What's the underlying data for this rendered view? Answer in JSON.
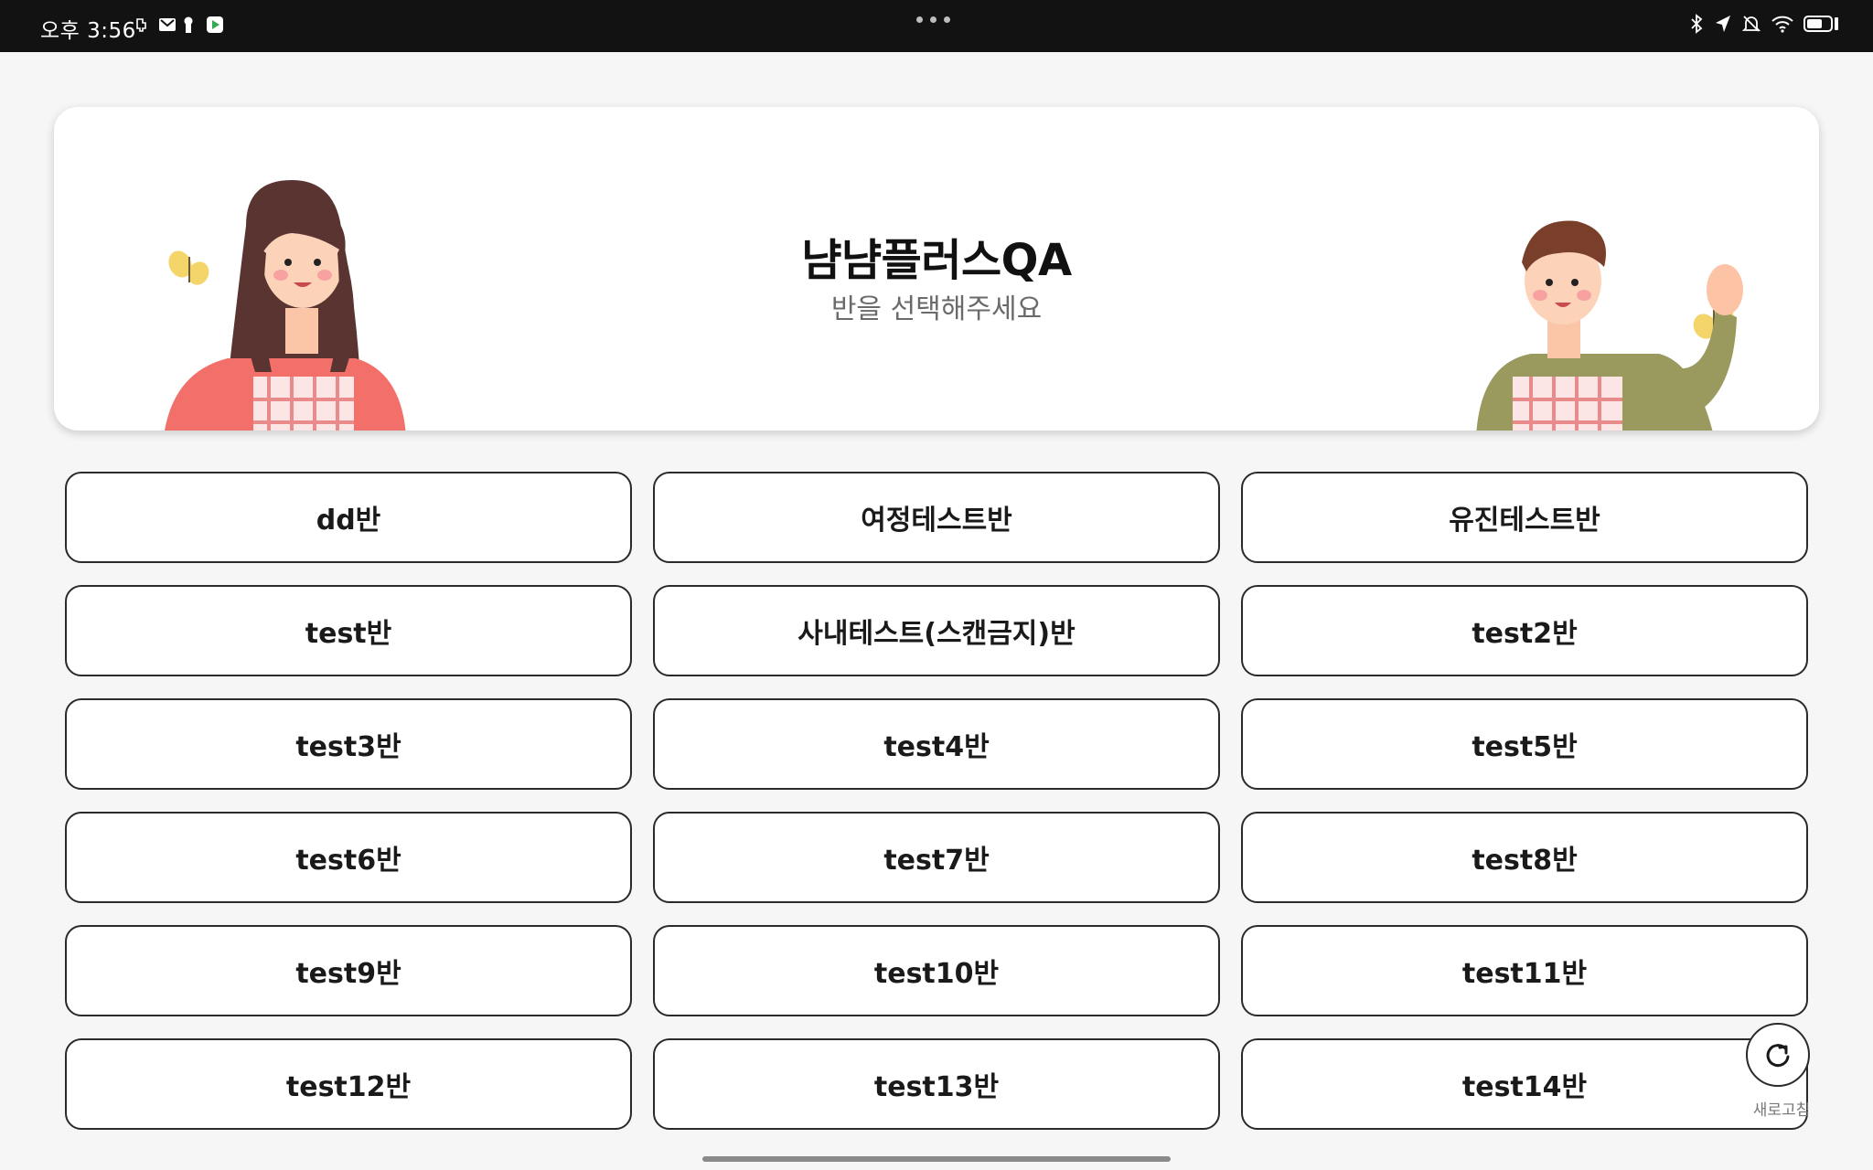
{
  "status_bar": {
    "time": "오후 3:56",
    "left_icons": [
      "usb-debug-icon",
      "gmail-icon",
      "keyhole-icon",
      "play-store-icon"
    ],
    "right_icons": [
      "bluetooth-icon",
      "location-icon",
      "bell-mute-icon",
      "wifi-icon",
      "battery-icon"
    ]
  },
  "header": {
    "title": "냠냠플러스QA",
    "subtitle": "반을 선택해주세요"
  },
  "classes": [
    "dd반",
    "여정테스트반",
    "유진테스트반",
    "test반",
    "사내테스트(스캔금지)반",
    "test2반",
    "test3반",
    "test4반",
    "test5반",
    "test6반",
    "test7반",
    "test8반",
    "test9반",
    "test10반",
    "test11반",
    "test12반",
    "test13반",
    "test14반"
  ],
  "refresh": {
    "label": "새로고침",
    "icon": "refresh-icon"
  },
  "colors": {
    "background": "#f6f6f6",
    "card": "#ffffff",
    "border": "#2a2a2a",
    "status_bar": "#121212"
  }
}
